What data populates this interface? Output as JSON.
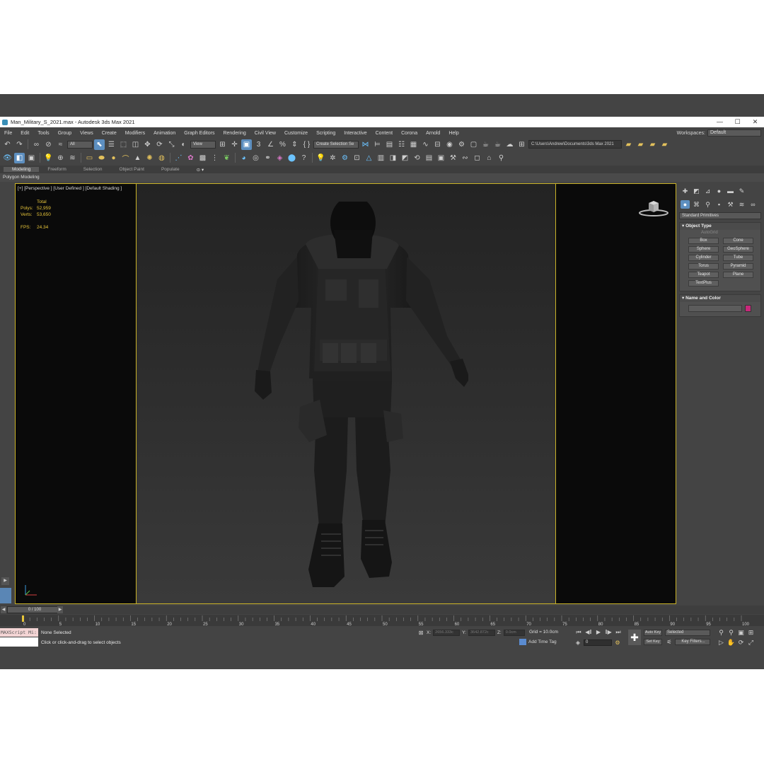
{
  "window": {
    "title": "Man_Military_S_2021.max - Autodesk 3ds Max 2021",
    "minimize": "—",
    "maximize": "☐",
    "close": "✕"
  },
  "menu": {
    "items": [
      "File",
      "Edit",
      "Tools",
      "Group",
      "Views",
      "Create",
      "Modifiers",
      "Animation",
      "Graph Editors",
      "Rendering",
      "Civil View",
      "Customize",
      "Scripting",
      "Interactive",
      "Content",
      "Corona",
      "Arnold",
      "Help"
    ],
    "workspaces_label": "Workspaces:",
    "workspace_value": "Default"
  },
  "toolbar": {
    "filter_value": "All",
    "refcoord_value": "View",
    "selection_set_value": "Create Selection Se",
    "project_path": "C:\\Users\\Andrew\\Documents\\3ds Max 2021"
  },
  "ribbon": {
    "tabs": [
      "Modeling",
      "Freeform",
      "Selection",
      "Object Paint",
      "Populate"
    ],
    "active_tab": "Modeling",
    "sub_label": "Polygon Modeling"
  },
  "viewport": {
    "label": "[+] [Perspective ] [User Defined ] [Default Shading ]",
    "stats_header": "Total",
    "polys_label": "Polys:",
    "polys_value": "52,959",
    "verts_label": "Verts:",
    "verts_value": "53,650",
    "fps_label": "FPS:",
    "fps_value": "24.34"
  },
  "command_panel": {
    "category": "Standard Primitives",
    "object_type_title": "Object Type",
    "autogrid_label": "AutoGrid",
    "primitives": [
      "Box",
      "Cone",
      "Sphere",
      "GeoSphere",
      "Cylinder",
      "Tube",
      "Torus",
      "Pyramid",
      "Teapot",
      "Plane",
      "TextPlus"
    ],
    "name_color_title": "Name and Color",
    "object_color": "#c8287a"
  },
  "timeline": {
    "slider_value": "0 / 100",
    "ticks": [
      "0",
      "5",
      "10",
      "15",
      "20",
      "25",
      "30",
      "35",
      "40",
      "45",
      "50",
      "55",
      "60",
      "65",
      "70",
      "75",
      "80",
      "85",
      "90",
      "95",
      "100"
    ]
  },
  "status": {
    "maxscript_label": "MAXScript Mi:",
    "selection_status": "None Selected",
    "prompt": "Click or click-and-drag to select objects",
    "x_label": "X:",
    "x_value": "2656.333c",
    "y_label": "Y:",
    "y_value": "3642.872c",
    "z_label": "Z:",
    "z_value": "0.0cm",
    "grid": "Grid = 10.0cm",
    "add_time_tag": "Add Time Tag",
    "current_frame": "0",
    "auto_key": "Auto Key",
    "set_key": "Set Key",
    "key_mode_value": "Selected",
    "key_filters": "Key Filters..."
  },
  "colors": {
    "accent_blue": "#5d8fc0",
    "viewport_border": "#c9b227",
    "stats_text": "#e7c53a"
  }
}
